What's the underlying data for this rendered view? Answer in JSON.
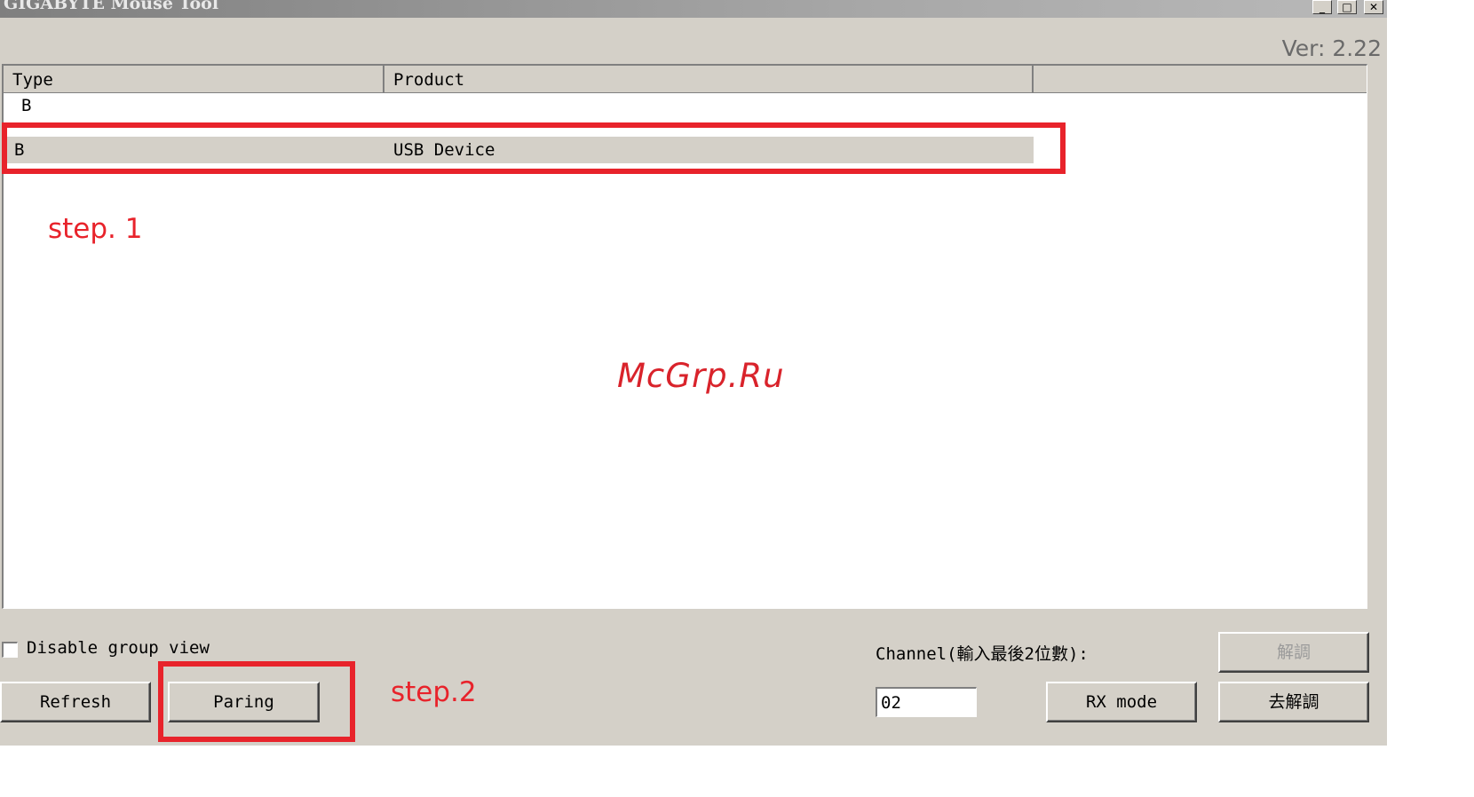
{
  "window": {
    "title": "GIGABYTE Mouse Tool",
    "version": "Ver: 2.22",
    "controls": {
      "minimize": "_",
      "maximize": "□",
      "close": "✕"
    }
  },
  "list": {
    "columns": [
      "Type",
      "Product",
      ""
    ],
    "group_label": "B",
    "rows": [
      {
        "type": "B",
        "product": "USB Device"
      }
    ]
  },
  "annotations": {
    "step1": "step. 1",
    "step2": "step.2",
    "watermark": "McGrp.Ru",
    "color": "#e8232b"
  },
  "bottom": {
    "disable_group_view_label": "Disable group view",
    "disable_group_view_checked": false,
    "refresh_label": "Refresh",
    "paring_label": "Paring",
    "channel_label": "Channel(輸入最後2位數):",
    "channel_value": "02",
    "rx_mode_label": "RX mode",
    "unpair_label": "解調",
    "go_unpair_label": "去解調"
  }
}
